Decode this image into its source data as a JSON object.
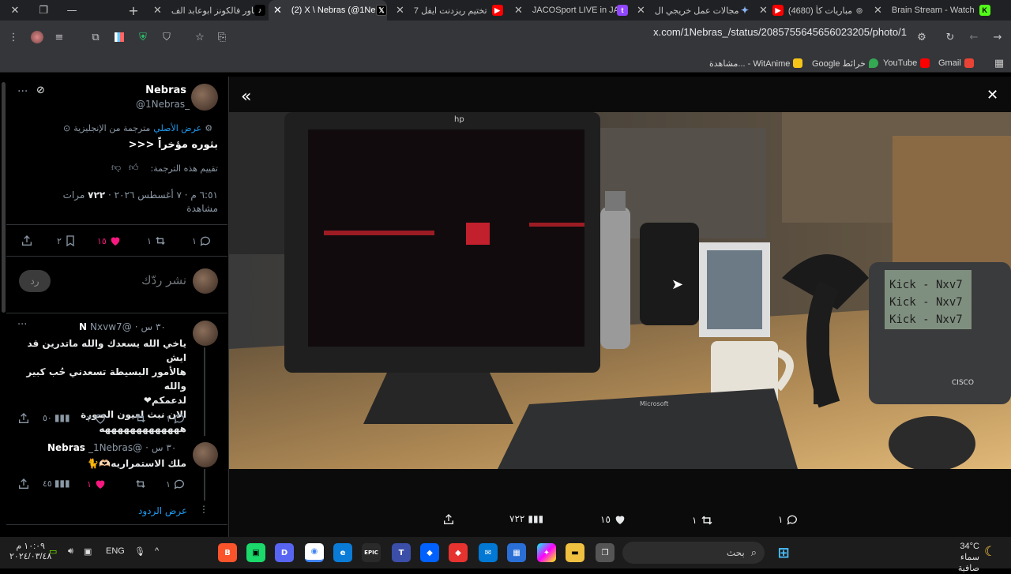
{
  "tabs": [
    {
      "title": "Brain Stream - Watch",
      "favicon": "green-k-icon",
      "active": false
    },
    {
      "title": "(4680) مباريات كأ",
      "favicon": "youtube-icon",
      "active": false
    },
    {
      "title": "مجالات عمل خريجي ال",
      "favicon": "gemini-icon",
      "active": false
    },
    {
      "title": "JACOSport LIVE in JA",
      "favicon": "twitch-icon",
      "active": false
    },
    {
      "title": "تختيم ريزدنت ايفل 7",
      "favicon": "youtube-icon",
      "active": false
    },
    {
      "title": "(2) X \\ Nebras (@1Ne",
      "favicon": "x-icon",
      "active": true
    },
    {
      "title": "باور فالكونز ابوعابد الف",
      "favicon": "tiktok-icon",
      "active": false
    }
  ],
  "toolbar": {
    "url": "x.com/1Nebras_/status/2085755645656023205/photo/1"
  },
  "bookmarks": [
    {
      "label": "Gmail",
      "color": "#ea4335"
    },
    {
      "label": "YouTube",
      "color": "#ff0000"
    },
    {
      "label": "Google خرائط",
      "color": "#34a853"
    },
    {
      "label": "مشاهدة... - WitAnime",
      "color": "#f5c518"
    }
  ],
  "tweet": {
    "name": "Nebras",
    "handle": "@1Nebras_",
    "translated_note": "مترجمة من الإنجليزية",
    "show_original": "عرض الأصلي",
    "text": "بثوره مؤخراً <<<",
    "rate_translation": "تقييم هذه الترجمة:",
    "timestamp_line": "٦:٥١ م · ٧ أغسطس ٢٠٢٦ ·",
    "views_count": "٧٢٢",
    "views_label": "مرات مشاهدة",
    "replies": "١",
    "retweets": "١",
    "likes": "١٥",
    "bookmarks": "٢"
  },
  "compose": {
    "placeholder": "نشر ردّك",
    "reply_button": "رد"
  },
  "replies": [
    {
      "name": "N",
      "handle": "@Nxvw7",
      "time": "٣٠ س",
      "lines": [
        "ياخي الله يسعدك والله ماتدرين قد ايش",
        "هالأمور البسيطة تسعدني حُب كبير والله",
        "لدعمكم❤",
        "الان نبث لعيون الصورة",
        "هههههههههههههه"
      ],
      "replies": "١",
      "likes": "٢",
      "views": "٥٠"
    },
    {
      "name": "Nebras",
      "handle": "@1Nebras_",
      "time": "٣٠ س",
      "lines": [
        "ملك الاستمراريه🫶🏻🐈"
      ],
      "replies": "١",
      "likes": "١",
      "views": "٤٥"
    }
  ],
  "show_replies": "عرض الردود",
  "viewer": {
    "replies": "١",
    "retweets": "١",
    "likes": "١٥",
    "views": "٧٢٢",
    "phone_screen": [
      "Kick - Nxv7",
      "Kick - Nxv7",
      "Kick - Nxv7"
    ],
    "monitor_brand": "hp",
    "keyboard_brand": "Microsoft",
    "phone_brand": "CISCO"
  },
  "taskbar": {
    "search_placeholder": "بحث",
    "weather_temp": "34°C",
    "weather_desc": "سماء صافية",
    "language": "ENG",
    "time": "١٠:٠٩ م",
    "date": "٢٠٢٤/٠٣/٤٨"
  }
}
